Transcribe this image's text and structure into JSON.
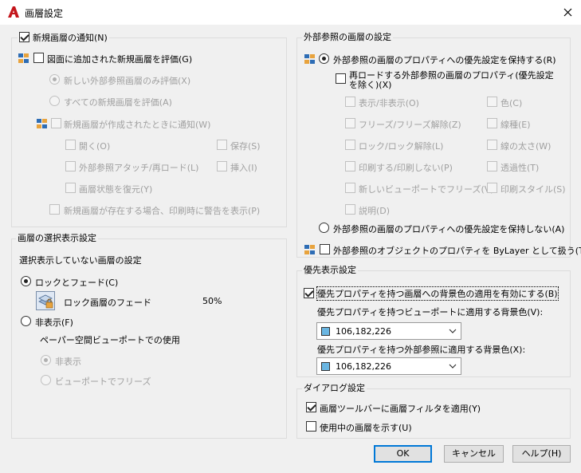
{
  "window": {
    "title": "画層設定"
  },
  "new_layer_notify": {
    "title": "新規画層の通知(N)",
    "evaluate_new_layers": "図面に追加された新規画層を評価(G)",
    "xref_only": "新しい外部参照画層のみ評価(X)",
    "all_new": "すべての新規画層を評価(A)",
    "notify_when_created": "新規画層が作成されたときに通知(W)",
    "open": "開く(O)",
    "save": "保存(S)",
    "attach_reload": "外部参照アタッチ/再ロード(L)",
    "insert": "挿入(I)",
    "restore_state": "画層状態を復元(Y)",
    "warn_on_plot": "新規画層が存在する場合、印刷時に警告を表示(P)"
  },
  "isolate": {
    "title": "画層の選択表示設定",
    "subtitle": "選択表示していない画層の設定",
    "lock_fade": "ロックとフェード(C)",
    "fade_label": "ロック画層のフェード",
    "fade_value": "50%",
    "hide": "非表示(F)",
    "paper_space_label": "ペーパー空間ビューポートでの使用",
    "ps_hide": "非表示",
    "ps_freeze": "ビューポートでフリーズ"
  },
  "xref": {
    "title": "外部参照の画層の設定",
    "retain_overrides": "外部参照の画層のプロパティへの優先設定を保持する(R)",
    "except_reload_line1": "再ロードする外部参照の画層のプロパティ(優先設定",
    "except_reload_line2": "を除く)(X)",
    "props_left": [
      "表示/非表示(O)",
      "フリーズ/フリーズ解除(Z)",
      "ロック/ロック解除(L)",
      "印刷する/印刷しない(P)",
      "新しいビューポートでフリーズ(V)",
      "説明(D)"
    ],
    "props_right": [
      "色(C)",
      "線種(E)",
      "線の太さ(W)",
      "透過性(T)",
      "印刷スタイル(S)"
    ],
    "no_retain": "外部参照の画層のプロパティへの優先設定を保持しない(A)",
    "bylayer": "外部参照のオブジェクトのプロパティを ByLayer として扱う(T)"
  },
  "override": {
    "title": "優先表示設定",
    "enable_bg": "優先プロパティを持つ画層への背景色の適用を有効にする(B)",
    "viewport_bg_label": "優先プロパティを持つビューポートに適用する背景色(V):",
    "viewport_bg_value": "106,182,226",
    "xref_bg_label": "優先プロパティを持つ外部参照に適用する背景色(X):",
    "xref_bg_value": "106,182,226",
    "swatch_color": "#6ab6e2"
  },
  "dialog": {
    "title": "ダイアログ設定",
    "apply_filter": "画層ツールバーに画層フィルタを適用(Y)",
    "show_in_use": "使用中の画層を示す(U)"
  },
  "buttons": {
    "ok": "OK",
    "cancel": "キャンセル",
    "help": "ヘルプ(H)"
  }
}
